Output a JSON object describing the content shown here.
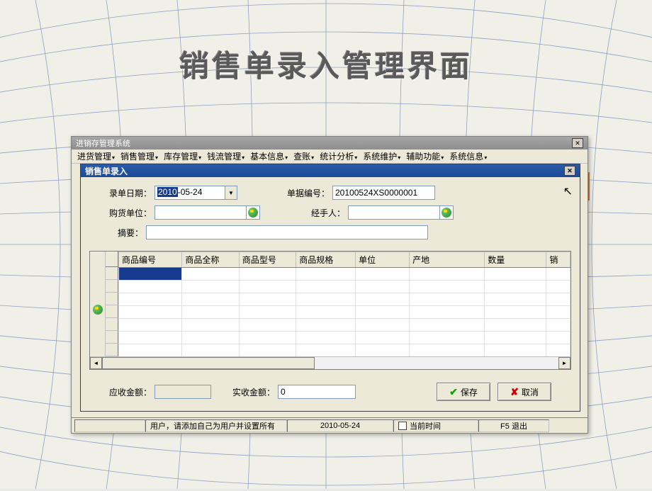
{
  "page_title": "销售单录入管理界面",
  "main_window": {
    "title": "进销存管理系统"
  },
  "menu": {
    "items": [
      "进货管理",
      "销售管理",
      "库存管理",
      "钱流管理",
      "基本信息",
      "查账",
      "统计分析",
      "系统维护",
      "辅助功能",
      "系统信息"
    ]
  },
  "child_window": {
    "title": "销售单录入"
  },
  "form": {
    "entry_date_label": "录单日期：",
    "entry_date_year": "2010",
    "entry_date_rest": "-05-24",
    "doc_no_label": "单据编号：",
    "doc_no_value": "20100524XS0000001",
    "buyer_label": "购货单位：",
    "buyer_value": "",
    "handler_label": "经手人：",
    "handler_value": "",
    "summary_label": "摘要：",
    "summary_value": ""
  },
  "table": {
    "columns": [
      "商品编号",
      "商品全称",
      "商品型号",
      "商品规格",
      "单位",
      "产地",
      "数量",
      "销"
    ]
  },
  "amounts": {
    "receivable_label": "应收金额：",
    "receivable_value": "",
    "received_label": "实收金额：",
    "received_value": "0"
  },
  "buttons": {
    "save": "保存",
    "cancel": "取消"
  },
  "statusbar": {
    "user_hint": "用户，请添加自己为用户并设置所有",
    "date": "2010-05-24",
    "current_time_label": "当前时间",
    "exit_label": "F5 退出"
  }
}
